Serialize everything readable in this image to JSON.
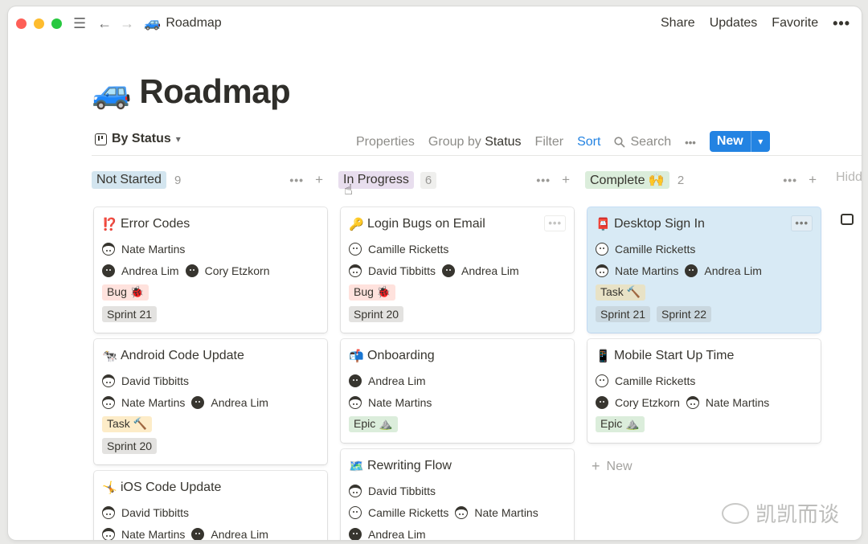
{
  "window": {
    "breadcrumb": {
      "emoji": "🚙",
      "label": "Roadmap"
    },
    "actions": {
      "share": "Share",
      "updates": "Updates",
      "favorite": "Favorite",
      "more": "•••"
    }
  },
  "page": {
    "emoji": "🚙",
    "title": "Roadmap"
  },
  "viewbar": {
    "view_label": "By Status",
    "properties": "Properties",
    "group_by_prefix": "Group by",
    "group_by_value": "Status",
    "filter": "Filter",
    "sort": "Sort",
    "search": "Search",
    "more": "•••",
    "new": "New"
  },
  "columns": [
    {
      "name": "Not Started",
      "color": "#d3e5ef",
      "count": "9",
      "cards": [
        {
          "emoji": "⁉️",
          "title": "Error Codes",
          "row1": [
            "Nate Martins"
          ],
          "row2": [
            "Andrea Lim",
            "Cory Etzkorn"
          ],
          "tag": "Bug 🐞",
          "sprints": [
            "Sprint 21"
          ]
        },
        {
          "emoji": "🐄",
          "title": "Android Code Update",
          "row1": [
            "David Tibbitts"
          ],
          "row2": [
            "Nate Martins",
            "Andrea Lim"
          ],
          "tag": "Task 🔨",
          "sprints": [
            "Sprint 20"
          ]
        },
        {
          "emoji": "🤸",
          "title": "iOS Code Update",
          "row1": [
            "David Tibbitts"
          ],
          "row2": [
            "Nate Martins",
            "Andrea Lim"
          ]
        }
      ]
    },
    {
      "name": "In Progress",
      "color": "#e8deee",
      "count": "6",
      "cards": [
        {
          "emoji": "🔑",
          "title": "Login Bugs on Email",
          "row1": [
            "Camille Ricketts"
          ],
          "row2": [
            "David Tibbitts",
            "Andrea Lim"
          ],
          "tag": "Bug 🐞",
          "sprints": [
            "Sprint 20"
          ]
        },
        {
          "emoji": "📬",
          "title": "Onboarding",
          "row1": [
            "Andrea Lim"
          ],
          "row2": [
            "Nate Martins"
          ],
          "tag": "Epic ⛰️"
        },
        {
          "emoji": "🗺️",
          "title": "Rewriting Flow",
          "row1": [
            "David Tibbitts"
          ],
          "row2": [
            "Camille Ricketts",
            "Nate Martins"
          ],
          "row3": [
            "Andrea Lim"
          ]
        }
      ]
    },
    {
      "name": "Complete 🙌",
      "color": "#dbeddb",
      "count": "2",
      "cards": [
        {
          "emoji": "📮",
          "title": "Desktop Sign In",
          "row1": [
            "Camille Ricketts"
          ],
          "row2": [
            "Nate Martins",
            "Andrea Lim"
          ],
          "tag": "Task 🔨",
          "sprints": [
            "Sprint 21",
            "Sprint 22"
          ]
        },
        {
          "emoji": "📱",
          "title": "Mobile Start Up Time",
          "row1": [
            "Camille Ricketts"
          ],
          "row2": [
            "Cory Etzkorn",
            "Nate Martins"
          ],
          "tag": "Epic ⛰️"
        }
      ],
      "new_label": "New"
    }
  ],
  "hidden_label": "Hidd",
  "watermark": "凯凯而谈"
}
